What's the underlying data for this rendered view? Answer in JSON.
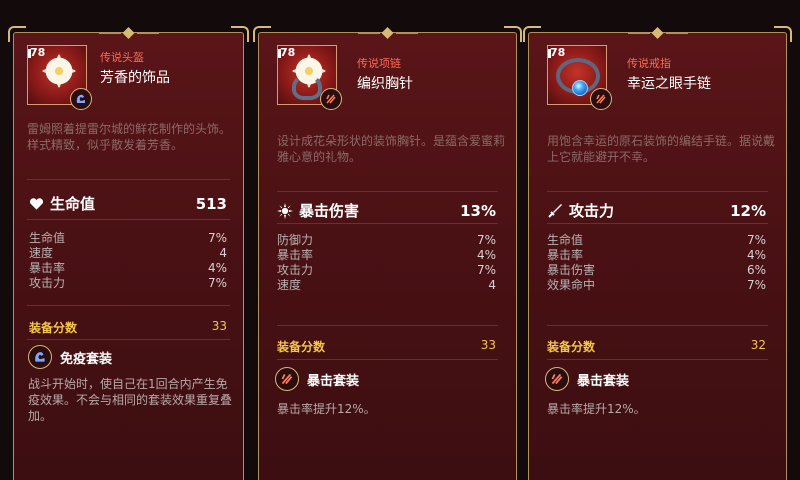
{
  "cards": [
    {
      "level": "78",
      "rarity": "传说头盔",
      "name": "芳香的饰品",
      "description": "雷姆照着提雷尔城的鲜花制作的头饰。样式精致，似乎散发着芳香。",
      "main_stat": {
        "icon": "heart-icon",
        "label": "生命值",
        "value": "513"
      },
      "substats": [
        {
          "label": "生命值",
          "value": "7%"
        },
        {
          "label": "速度",
          "value": "4"
        },
        {
          "label": "暴击率",
          "value": "4%"
        },
        {
          "label": "攻击力",
          "value": "7%"
        }
      ],
      "score_label": "装备分数",
      "score_value": "33",
      "set_icon": "immunity-set-icon",
      "set_name": "免疫套装",
      "set_desc": "战斗开始时，使自己在1回合内产生免疫效果。不会与相同的套装效果重复叠加。"
    },
    {
      "level": "78",
      "rarity": "传说项链",
      "name": "编织胸针",
      "description": "设计成花朵形状的装饰胸针。是蕴含爱蜜莉雅心意的礼物。",
      "main_stat": {
        "icon": "critical-damage-icon",
        "label": "暴击伤害",
        "value": "13%"
      },
      "substats": [
        {
          "label": "防御力",
          "value": "7%"
        },
        {
          "label": "暴击率",
          "value": "4%"
        },
        {
          "label": "攻击力",
          "value": "7%"
        },
        {
          "label": "速度",
          "value": "4"
        }
      ],
      "score_label": "装备分数",
      "score_value": "33",
      "set_icon": "critical-set-icon",
      "set_name": "暴击套装",
      "set_desc": "暴击率提升12%。"
    },
    {
      "level": "78",
      "rarity": "传说戒指",
      "name": "幸运之眼手链",
      "description": "用饱含幸运的原石装饰的编结手链。据说戴上它就能避开不幸。",
      "main_stat": {
        "icon": "sword-icon",
        "label": "攻击力",
        "value": "12%"
      },
      "substats": [
        {
          "label": "生命值",
          "value": "7%"
        },
        {
          "label": "暴击率",
          "value": "4%"
        },
        {
          "label": "暴击伤害",
          "value": "6%"
        },
        {
          "label": "效果命中",
          "value": "7%"
        }
      ],
      "score_label": "装备分数",
      "score_value": "32",
      "set_icon": "critical-set-icon",
      "set_name": "暴击套装",
      "set_desc": "暴击率提升12%。"
    }
  ],
  "colors": {
    "card_bg": "#4a1114",
    "gold_border": "#b3915a",
    "rarity_red": "#ff6a55",
    "score_gold": "#f4c64c"
  }
}
